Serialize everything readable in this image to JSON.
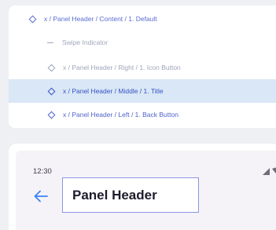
{
  "layers": {
    "items": [
      {
        "label": "x / Panel Header / Content / 1. Default",
        "icon": "diamond-component-icon",
        "state": "root"
      },
      {
        "label": "Swipe Indicator",
        "icon": "dash-icon",
        "state": "normal"
      },
      {
        "label": "x / Panel Header / Right / 1. Icon Button",
        "icon": "diamond-component-icon",
        "state": "normal"
      },
      {
        "label": "x / Panel Header / Middle / 1. Title",
        "icon": "diamond-component-icon",
        "state": "selected"
      },
      {
        "label": "x / Panel Header / Left / 1. Back Button",
        "icon": "diamond-component-icon",
        "state": "normal"
      }
    ]
  },
  "device": {
    "time": "12:30",
    "status_icons": [
      "signal-icon",
      "wifi-icon"
    ],
    "back_icon": "arrow-left-icon",
    "title": "Panel Header"
  },
  "colors": {
    "selected_row": "#d9e7f6",
    "accent": "#5a6dd1",
    "back_arrow": "#3b82f6"
  }
}
